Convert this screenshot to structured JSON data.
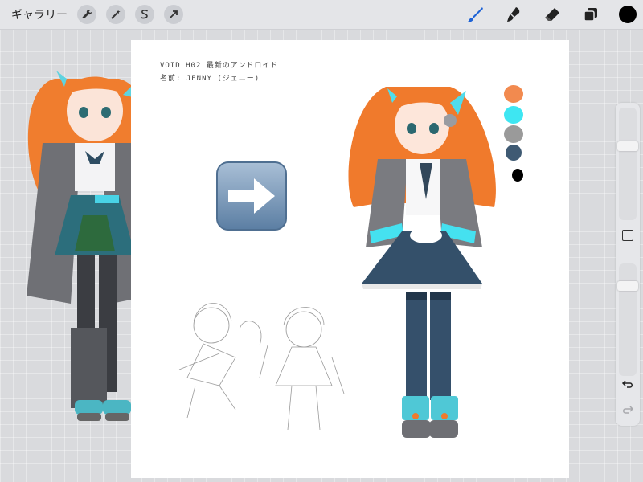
{
  "topbar": {
    "gallery_label": "ギャラリー",
    "left_tools": [
      "wrench-icon",
      "magic-wand-icon",
      "selection-icon",
      "transform-arrow-icon"
    ],
    "right_tools": [
      "brush-icon",
      "smudge-icon",
      "eraser-icon",
      "layers-icon"
    ],
    "current_color": "#000000",
    "accent_color": "#1e63d6"
  },
  "canvas": {
    "notes": {
      "line1": "VOID H02 最新のアンドロイド",
      "line2": "名前: JENNY (ジェニー)"
    },
    "palette": [
      "#f28a4f",
      "#3ee6f2",
      "#9a9a9a",
      "#3f5a73",
      "#000000"
    ]
  }
}
